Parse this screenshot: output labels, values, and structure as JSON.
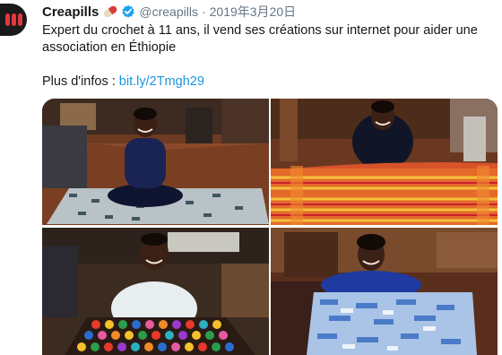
{
  "tweet": {
    "display_name": "Creapills",
    "handle": "@creapills",
    "separator": "·",
    "date": "2019年3月20日",
    "text_line1": "Expert du crochet à 11 ans, il vend ses créations sur internet pour aider une",
    "text_line2": "association en Éthiopie",
    "more_info_label": "Plus d'infos : ",
    "link": "bit.ly/2Tmgh29"
  },
  "icons": {
    "avatar": "creapills-logo",
    "emoji": "pill-emoji",
    "verified": "verified-badge-icon"
  },
  "colors": {
    "text": "#14171a",
    "muted": "#657786",
    "link": "#1b95e0",
    "verified": "#1da1f2"
  }
}
